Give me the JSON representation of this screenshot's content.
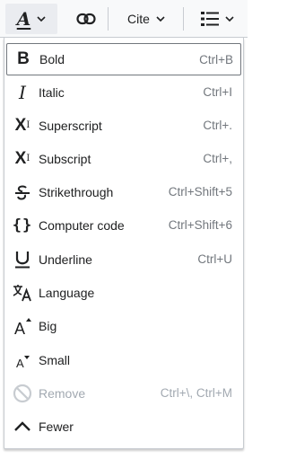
{
  "toolbar": {
    "style_icon": "text-style-icon",
    "style_letter": "A",
    "link_icon": "link-icon",
    "cite_label": "Cite",
    "list_icon": "bullet-list-icon"
  },
  "menu": {
    "items": [
      {
        "label": "Bold",
        "shortcut": "Ctrl+B",
        "icon": "bold-icon",
        "glyph": "B",
        "state": "selected"
      },
      {
        "label": "Italic",
        "shortcut": "Ctrl+I",
        "icon": "italic-icon",
        "glyph": "I"
      },
      {
        "label": "Superscript",
        "shortcut": "Ctrl+.",
        "icon": "superscript-icon",
        "glyph": "X",
        "mark": "I"
      },
      {
        "label": "Subscript",
        "shortcut": "Ctrl+,",
        "icon": "subscript-icon",
        "glyph": "X",
        "mark": "I"
      },
      {
        "label": "Strikethrough",
        "shortcut": "Ctrl+Shift+5",
        "icon": "strikethrough-icon"
      },
      {
        "label": "Computer code",
        "shortcut": "Ctrl+Shift+6",
        "icon": "code-icon",
        "glyph": "{}"
      },
      {
        "label": "Underline",
        "shortcut": "Ctrl+U",
        "icon": "underline-icon",
        "glyph": "U"
      },
      {
        "label": "Language",
        "shortcut": "",
        "icon": "language-icon"
      },
      {
        "label": "Big",
        "shortcut": "",
        "icon": "big-text-icon",
        "glyph": "A"
      },
      {
        "label": "Small",
        "shortcut": "",
        "icon": "small-text-icon",
        "glyph": "A"
      },
      {
        "label": "Remove",
        "shortcut": "Ctrl+\\, Ctrl+M",
        "icon": "remove-format-icon",
        "state": "disabled"
      },
      {
        "label": "Fewer",
        "shortcut": "",
        "icon": "chevron-up-icon"
      }
    ]
  },
  "colors": {
    "text": "#202122",
    "shortcut": "#72777d",
    "disabled": "#a2a9b1",
    "border": "#c8ccd1",
    "toolbar_bg": "#f8f9fa",
    "active_bg": "#eaecf0"
  }
}
